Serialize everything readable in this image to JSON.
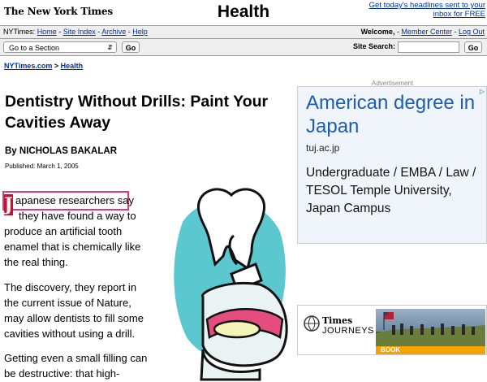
{
  "masthead": {
    "logo": "The New York Times",
    "section": "Health",
    "promo_line1": "Get today's headlines sent to your",
    "promo_line2": "inbox for FREE"
  },
  "navbar": {
    "prefix": "NYTimes:",
    "links": [
      "Home",
      "Site Index",
      "Archive",
      "Help"
    ],
    "welcome": "Welcome,",
    "member_center": "Member Center",
    "log_out": "Log Out"
  },
  "toolbar": {
    "section_select": "Go to a Section",
    "go_label": "Go",
    "site_search_label": "Site Search:",
    "search_value": "",
    "search_go": "Go"
  },
  "breadcrumb": {
    "home": "NYTimes.com",
    "separator": ">",
    "current": "Health"
  },
  "article": {
    "title": "Dentistry Without Drills: Paint Your Cavities Away",
    "byline": "By NICHOLAS BAKALAR",
    "pubdate": "Published: March 1, 2005",
    "dropcap": "J",
    "p1": [
      "apanese researchers say",
      "they have found a way to",
      "produce an artificial tooth",
      "enamel that is chemically like",
      "the real thing."
    ],
    "p2": [
      "The discovery, they report in",
      "the current issue of Nature,",
      "may allow dentists to fill some",
      "cavities without using a drill."
    ],
    "p3": [
      "Getting even a small filling can",
      "be destructive: that high-"
    ]
  },
  "ad": {
    "label": "Advertisement",
    "headline": "American degree in Japan",
    "url": "tuj.ac.jp",
    "body": "Undergraduate / EMBA / Law / TESOL Temple University, Japan Campus"
  },
  "times_journeys": {
    "brand": "Times",
    "sub": "JOURNEYS",
    "cta": "BOOK"
  },
  "colors": {
    "link": "#00309c",
    "dropcap": "#c8102e",
    "highlight": "#e03a74",
    "ad_headline": "#1a5cb8",
    "illustration_teal": "#5bc8d0"
  }
}
